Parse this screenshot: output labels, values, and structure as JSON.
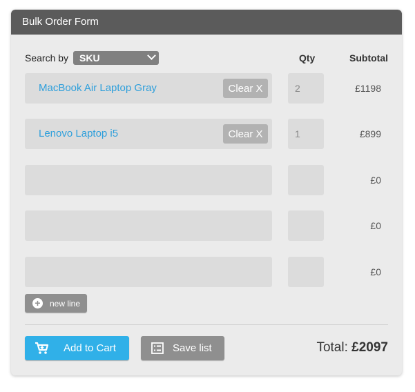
{
  "form": {
    "title": "Bulk Order Form",
    "search_label": "Search by",
    "search_value": "SKU",
    "col_qty": "Qty",
    "col_subtotal": "Subtotal"
  },
  "rows": [
    {
      "product": "MacBook Air Laptop Gray",
      "clear": "Clear X",
      "qty": "2",
      "subtotal": "£1198"
    },
    {
      "product": "Lenovo Laptop i5",
      "clear": "Clear X",
      "qty": "1",
      "subtotal": "£899"
    },
    {
      "product": "",
      "qty": "",
      "subtotal": "£0"
    },
    {
      "product": "",
      "qty": "",
      "subtotal": "£0"
    },
    {
      "product": "",
      "qty": "",
      "subtotal": "£0"
    }
  ],
  "actions": {
    "new_line": "new line",
    "add_to_cart": "Add to Cart",
    "save_list": "Save list"
  },
  "total": {
    "label": "Total:",
    "value": "£2097"
  },
  "colors": {
    "header_bg": "#5b5b5b",
    "accent": "#30b0e8",
    "link": "#2e9fdb",
    "button_gray": "#8f8f8f"
  }
}
